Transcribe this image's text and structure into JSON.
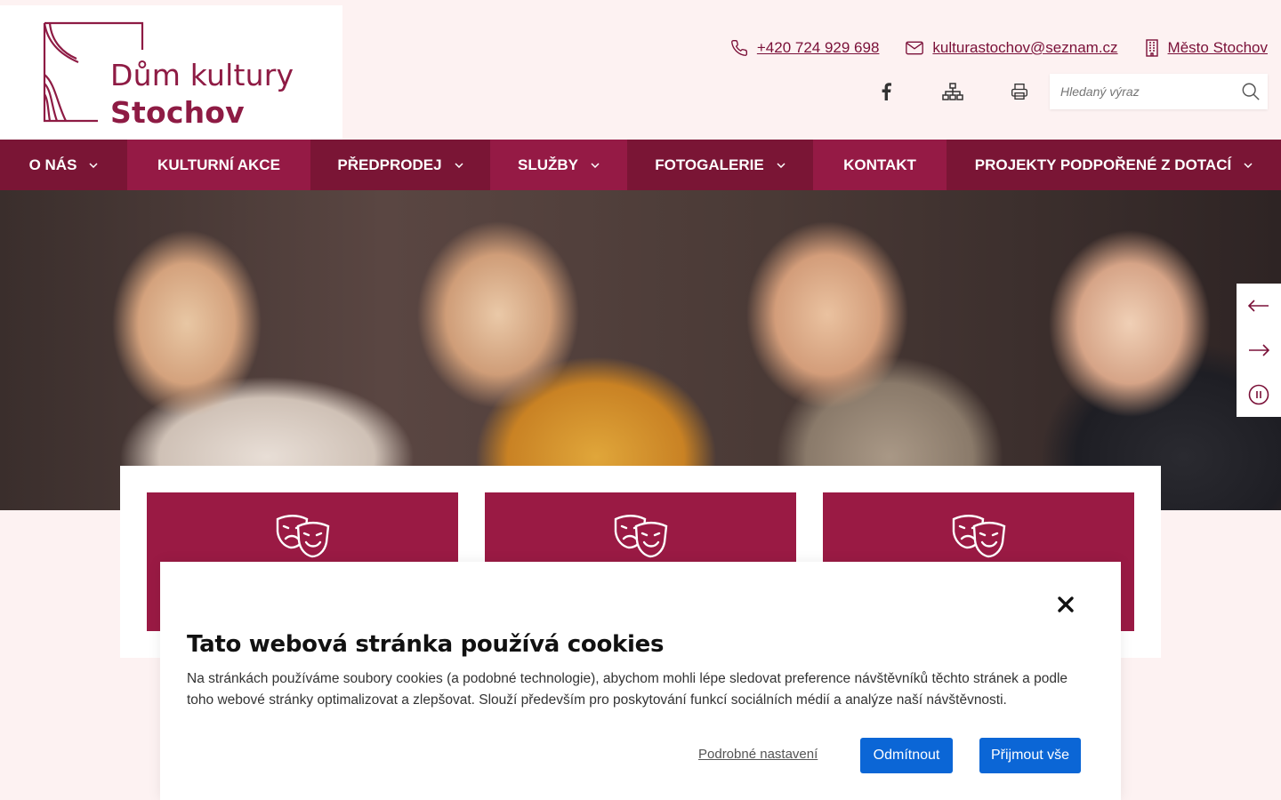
{
  "brand": {
    "line1": "Dům kultury",
    "line2": "Stochov",
    "color": "#8e1b44"
  },
  "contacts": [
    {
      "icon": "phone-icon",
      "label": "+420 724 929 698"
    },
    {
      "icon": "mail-icon",
      "label": "kulturastochov@seznam.cz"
    },
    {
      "icon": "building-icon",
      "label": "Město Stochov"
    }
  ],
  "tools": [
    "facebook-icon",
    "sitemap-icon",
    "print-icon"
  ],
  "search": {
    "placeholder": "Hledaný výraz",
    "icon": "search-icon"
  },
  "nav": [
    {
      "label": "O nás",
      "dropdown": true
    },
    {
      "label": "Kulturní akce",
      "dropdown": false
    },
    {
      "label": "Předprodej",
      "dropdown": true
    },
    {
      "label": "Služby",
      "dropdown": true
    },
    {
      "label": "Fotogalerie",
      "dropdown": true
    },
    {
      "label": "Kontakt",
      "dropdown": false
    },
    {
      "label": "Projekty podpořené z dotací",
      "dropdown": true
    }
  ],
  "hero_controls": [
    "arrow-left-icon",
    "arrow-right-icon",
    "pause-icon"
  ],
  "cards": [
    {
      "icon": "theater-masks-icon"
    },
    {
      "icon": "theater-masks-icon"
    },
    {
      "icon": "theater-masks-icon"
    }
  ],
  "cookie": {
    "title": "Tato webová stránka používá cookies",
    "text": "Na stránkách používáme soubory cookies (a podobné technologie), abychom mohli lépe sledovat preference návštěvníků těchto stránek a podle toho webové stránky optimalizovat a zlepšovat. Slouží především pro poskytování funkcí sociálních médií a analýze naší návštěvnosti.",
    "settings_link": "Podrobné nastavení",
    "decline": "Odmítnout",
    "accept": "Přijmout vše",
    "button_color": "#0b66d6"
  },
  "colors": {
    "nav_dark": "#7a1535",
    "nav_light": "#951a45",
    "card": "#9a1a44",
    "page_bg": "#fdf2f2"
  }
}
